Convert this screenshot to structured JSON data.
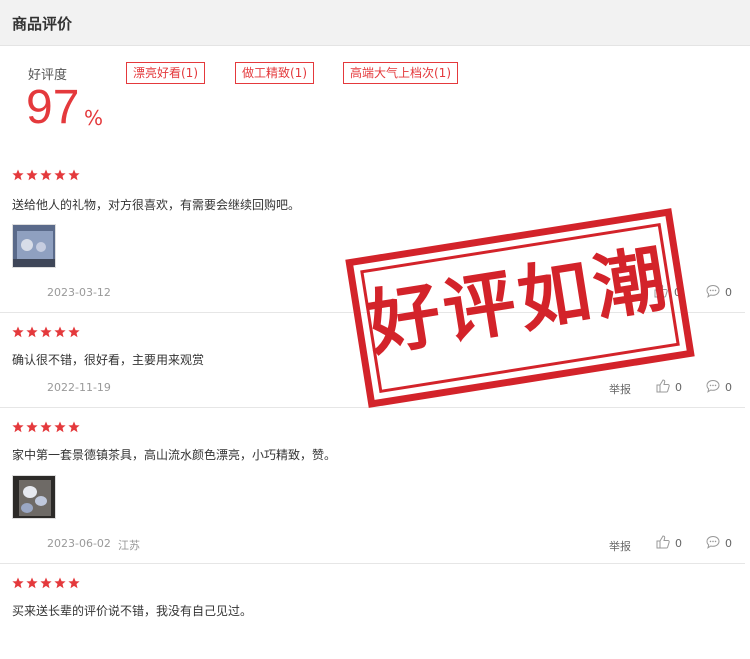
{
  "header": {
    "title": "商品评价"
  },
  "summary": {
    "rate_label": "好评度",
    "rate_value": "97",
    "rate_unit": "%"
  },
  "tags": [
    {
      "label": "漂亮好看(1)"
    },
    {
      "label": "做工精致(1)"
    },
    {
      "label": "高端大气上档次(1)"
    }
  ],
  "reviews": [
    {
      "stars": 5,
      "text": "送给他人的礼物，对方很喜欢，有需要会继续回购吧。",
      "date": "2023-03-12",
      "location": "",
      "report": "",
      "likes": "0",
      "comments": "0"
    },
    {
      "stars": 5,
      "text": "确认很不错，很好看，主要用来观赏",
      "date": "2022-11-19",
      "location": "",
      "report": "举报",
      "likes": "0",
      "comments": "0"
    },
    {
      "stars": 5,
      "text": "家中第一套景德镇茶具，高山流水颜色漂亮，小巧精致，赞。",
      "date": "2023-06-02",
      "location": "江苏",
      "report": "举报",
      "likes": "0",
      "comments": "0"
    },
    {
      "stars": 5,
      "text": "买来送长辈的评价说不错，我没有自己见过。",
      "date": "",
      "location": "",
      "report": "",
      "likes": "",
      "comments": ""
    }
  ],
  "stamp": {
    "text": "好评如潮"
  },
  "colors": {
    "accent": "#e4393c",
    "stamp": "#d3232a",
    "header_bg": "#f2f2f2"
  }
}
